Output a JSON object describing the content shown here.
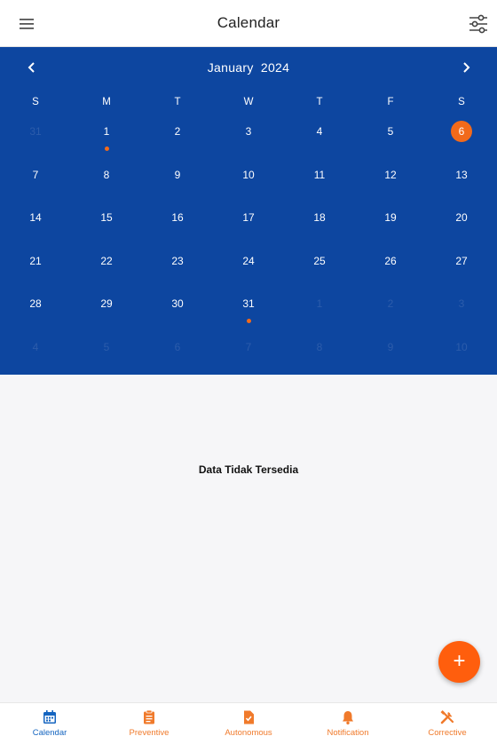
{
  "header": {
    "title": "Calendar",
    "menu_icon": "hamburger-menu-icon",
    "filter_icon": "sliders-filter-icon"
  },
  "calendar": {
    "month": "January",
    "year": "2024",
    "weekdays": [
      "S",
      "M",
      "T",
      "W",
      "T",
      "F",
      "S"
    ],
    "weeks": [
      [
        {
          "d": "31",
          "muted": true
        },
        {
          "d": "1",
          "dot": true
        },
        {
          "d": "2"
        },
        {
          "d": "3"
        },
        {
          "d": "4"
        },
        {
          "d": "5"
        },
        {
          "d": "6",
          "selected": true
        }
      ],
      [
        {
          "d": "7"
        },
        {
          "d": "8"
        },
        {
          "d": "9"
        },
        {
          "d": "10"
        },
        {
          "d": "11"
        },
        {
          "d": "12"
        },
        {
          "d": "13"
        }
      ],
      [
        {
          "d": "14"
        },
        {
          "d": "15"
        },
        {
          "d": "16"
        },
        {
          "d": "17"
        },
        {
          "d": "18"
        },
        {
          "d": "19"
        },
        {
          "d": "20"
        }
      ],
      [
        {
          "d": "21"
        },
        {
          "d": "22"
        },
        {
          "d": "23"
        },
        {
          "d": "24"
        },
        {
          "d": "25"
        },
        {
          "d": "26"
        },
        {
          "d": "27"
        }
      ],
      [
        {
          "d": "28"
        },
        {
          "d": "29"
        },
        {
          "d": "30"
        },
        {
          "d": "31",
          "dot": true
        },
        {
          "d": "1",
          "muted": true
        },
        {
          "d": "2",
          "muted": true
        },
        {
          "d": "3",
          "muted": true
        }
      ],
      [
        {
          "d": "4",
          "muted": true
        },
        {
          "d": "5",
          "muted": true
        },
        {
          "d": "6",
          "muted": true
        },
        {
          "d": "7",
          "muted": true
        },
        {
          "d": "8",
          "muted": true
        },
        {
          "d": "9",
          "muted": true
        },
        {
          "d": "10",
          "muted": true
        }
      ]
    ]
  },
  "content": {
    "empty_message": "Data Tidak Tersedia"
  },
  "fab": {
    "label": "+"
  },
  "bottom_nav": [
    {
      "label": "Calendar",
      "icon": "calendar-icon",
      "active": true
    },
    {
      "label": "Preventive",
      "icon": "clipboard-icon"
    },
    {
      "label": "Autonomous",
      "icon": "document-check-icon"
    },
    {
      "label": "Notification",
      "icon": "bell-icon"
    },
    {
      "label": "Corrective",
      "icon": "tools-icon"
    }
  ],
  "colors": {
    "calendar_bg": "#0d46a0",
    "accent": "#f26a1b",
    "active_tab": "#1565c0"
  }
}
